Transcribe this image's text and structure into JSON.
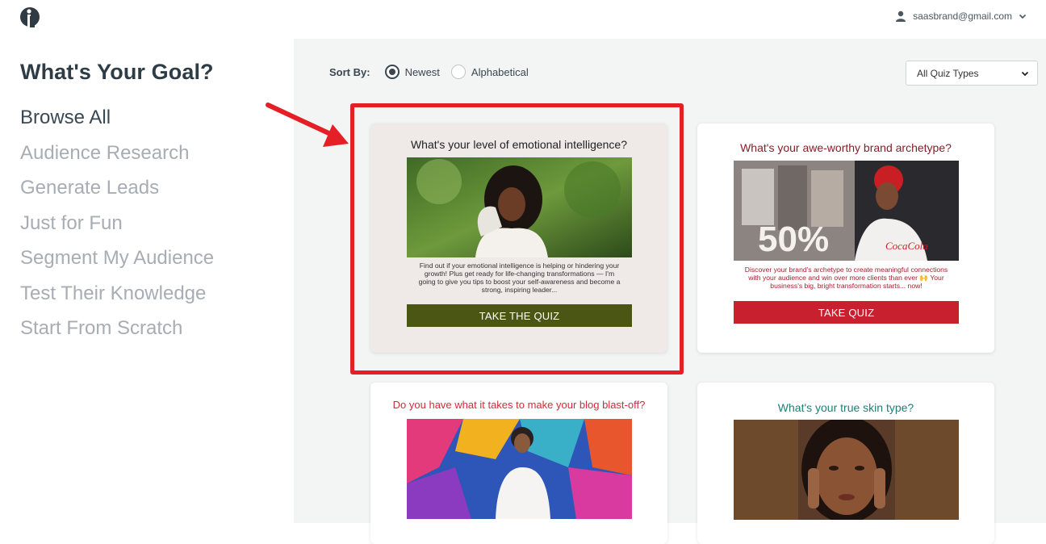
{
  "header": {
    "account_email": "saasbrand@gmail.com",
    "user_icon": "user-icon",
    "logo": "brand-logo"
  },
  "sidebar": {
    "title": "What's Your Goal?",
    "items": [
      {
        "label": "Browse All",
        "active": true
      },
      {
        "label": "Audience Research"
      },
      {
        "label": "Generate Leads"
      },
      {
        "label": "Just for Fun"
      },
      {
        "label": "Segment My Audience"
      },
      {
        "label": "Test Their Knowledge"
      },
      {
        "label": "Start From Scratch"
      }
    ]
  },
  "sort": {
    "label": "Sort By:",
    "options": [
      {
        "label": "Newest",
        "selected": true
      },
      {
        "label": "Alphabetical",
        "selected": false
      }
    ]
  },
  "filter": {
    "selected": "All Quiz Types"
  },
  "cards": [
    {
      "title": "What's your level of emotional intelligence?",
      "description": "Find out if your emotional intelligence is helping or hindering your growth! Plus get ready for life-changing transformations — I'm going to give you tips to boost your self-awareness and become a strong, inspiring leader...",
      "cta": "TAKE THE QUIZ",
      "accent": "#4b5514",
      "highlighted": true
    },
    {
      "title": "What's your awe-worthy brand archetype?",
      "description": "Discover your brand's archetype to create meaningful connections with your audience and win over more clients than ever 🙌 Your business's big, bright transformation starts... now!",
      "cta": "TAKE QUIZ",
      "accent": "#c8202f"
    },
    {
      "title": "Do you have what it takes to make your blog blast-off?",
      "accent": "#d6283a"
    },
    {
      "title": "What's your true skin type?",
      "accent": "#1f7e78"
    }
  ],
  "colors": {
    "highlight": "#e41f26",
    "main_bg": "#f3f4f4"
  }
}
